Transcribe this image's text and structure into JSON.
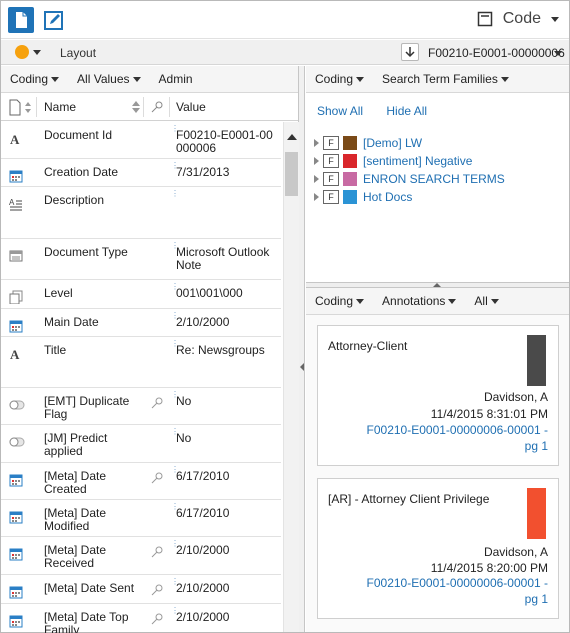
{
  "topbar": {
    "code_label": "Code"
  },
  "secondbar": {
    "layout_label": "Layout",
    "doc_id": "F00210-E0001-00000006"
  },
  "left": {
    "menu": [
      "Coding",
      "All Values",
      "Admin"
    ],
    "columns": {
      "name": "Name",
      "value": "Value"
    },
    "rows": [
      {
        "name": "Document Id",
        "value": "F00210-E0001-00000006",
        "icon": "text-field-icon"
      },
      {
        "name": "Creation Date",
        "value": "7/31/2013",
        "icon": "calendar-icon"
      },
      {
        "name": "Description",
        "value": "",
        "icon": "paragraph-icon"
      },
      {
        "name": "Document Type",
        "value": "Microsoft Outlook Note",
        "icon": "list-icon"
      },
      {
        "name": "Level",
        "value": "001\\001\\000",
        "icon": "pages-icon"
      },
      {
        "name": "Main Date",
        "value": "2/10/2000",
        "icon": "calendar-icon"
      },
      {
        "name": "Title",
        "value": "Re: Newsgroups",
        "icon": "text-field-icon"
      },
      {
        "name": "[EMT] Duplicate Flag",
        "value": "No",
        "icon": "toggle-icon",
        "key": true
      },
      {
        "name": "[JM] Predict applied",
        "value": "No",
        "icon": "toggle-icon"
      },
      {
        "name": "[Meta] Date Created",
        "value": "6/17/2010",
        "icon": "calendar-icon",
        "key": true
      },
      {
        "name": "[Meta] Date Modified",
        "value": "6/17/2010",
        "icon": "calendar-icon"
      },
      {
        "name": "[Meta] Date Received",
        "value": "2/10/2000",
        "icon": "calendar-icon",
        "key": true
      },
      {
        "name": "[Meta] Date Sent",
        "value": "2/10/2000",
        "icon": "calendar-icon",
        "key": true
      },
      {
        "name": "[Meta] Date Top Family",
        "value": "2/10/2000",
        "icon": "calendar-icon",
        "key": true
      }
    ]
  },
  "rtop": {
    "menu": [
      "Coding",
      "Search Term Families"
    ],
    "show_all": "Show All",
    "hide_all": "Hide All",
    "tree": [
      {
        "label": "[Demo] LW",
        "color": "#7a4a17"
      },
      {
        "label": "[sentiment] Negative",
        "color": "#d9262b"
      },
      {
        "label": "ENRON SEARCH TERMS",
        "color": "#c86aa3"
      },
      {
        "label": "Hot Docs",
        "color": "#2a93d5"
      }
    ]
  },
  "rbot": {
    "menu": [
      "Coding",
      "Annotations",
      "All"
    ],
    "cards": [
      {
        "title": "Attorney-Client",
        "color": "#4a4a4a",
        "author": "Davidson, A",
        "date": "11/4/2015 8:31:01 PM",
        "link": "F00210-E0001-00000006-00001 - pg 1"
      },
      {
        "title": "[AR] - Attorney Client Privilege",
        "color": "#f2502f",
        "author": "Davidson, A",
        "date": "11/4/2015 8:20:00 PM",
        "link": "F00210-E0001-00000006-00001 - pg 1"
      }
    ]
  }
}
